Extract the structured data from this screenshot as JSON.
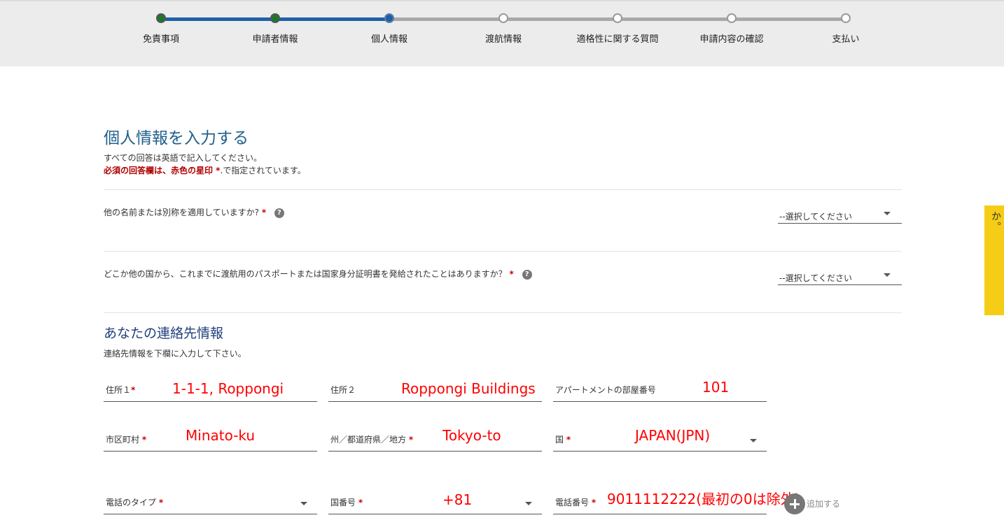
{
  "progress": {
    "steps": [
      {
        "label": "免責事項",
        "state": "done"
      },
      {
        "label": "申請者情報",
        "state": "done"
      },
      {
        "label": "個人情報",
        "state": "current"
      },
      {
        "label": "渡航情報",
        "state": "todo"
      },
      {
        "label": "適格性に関する質問",
        "state": "todo"
      },
      {
        "label": "申請内容の確認",
        "state": "todo"
      },
      {
        "label": "支払い",
        "state": "todo"
      }
    ]
  },
  "page": {
    "title": "個人情報を入力する",
    "instruction": "すべての回答は英語で記入してください。",
    "required_note_red": "必須の回答欄は、赤色の星印 *",
    "required_note_rest": ".で指定されています。"
  },
  "questions": [
    {
      "label": "他の名前または別称を適用していますか?",
      "required": "*",
      "help_icon": "?",
      "select_value": "--選択してください"
    },
    {
      "label": "どこか他の国から、これまでに渡航用のパスポートまたは国家身分証明書を発給されたことはありますか？",
      "required": "*",
      "help_icon": "?",
      "select_value": "--選択してください"
    }
  ],
  "contact": {
    "title": "あなたの連絡先情報",
    "subtitle": "連絡先情報を下欄に入力して下さい。",
    "address1": {
      "label": "住所１",
      "required": "*",
      "value": "1-1-1, Roppongi"
    },
    "address2": {
      "label": "住所２",
      "value": "Roppongi Buildings"
    },
    "apartment": {
      "label": "アパートメントの部屋番号",
      "value": "101"
    },
    "city": {
      "label": "市区町村",
      "required": "*",
      "value": "Minato-ku"
    },
    "state": {
      "label": "州／都道府県／地方",
      "required": "*",
      "value": "Tokyo-to"
    },
    "country": {
      "label": "国",
      "required": "*",
      "value": "JAPAN(JPN)"
    },
    "phone_type": {
      "label": "電話のタイプ",
      "required": "*",
      "value": ""
    },
    "country_code": {
      "label": "国番号",
      "required": "*",
      "value": "+81"
    },
    "phone_number": {
      "label": "電話番号",
      "required": "*",
      "value": "9011112222(最初の0は除外)"
    },
    "add_label": "追加する"
  },
  "help_tab": {
    "label": "ヘルプが必要ですか。"
  },
  "colors": {
    "accent": "#1f5fa8",
    "done": "#1b7a2a",
    "required": "#cc0000",
    "annotation": "#ff0000",
    "help_tab": "#f5cd16"
  }
}
